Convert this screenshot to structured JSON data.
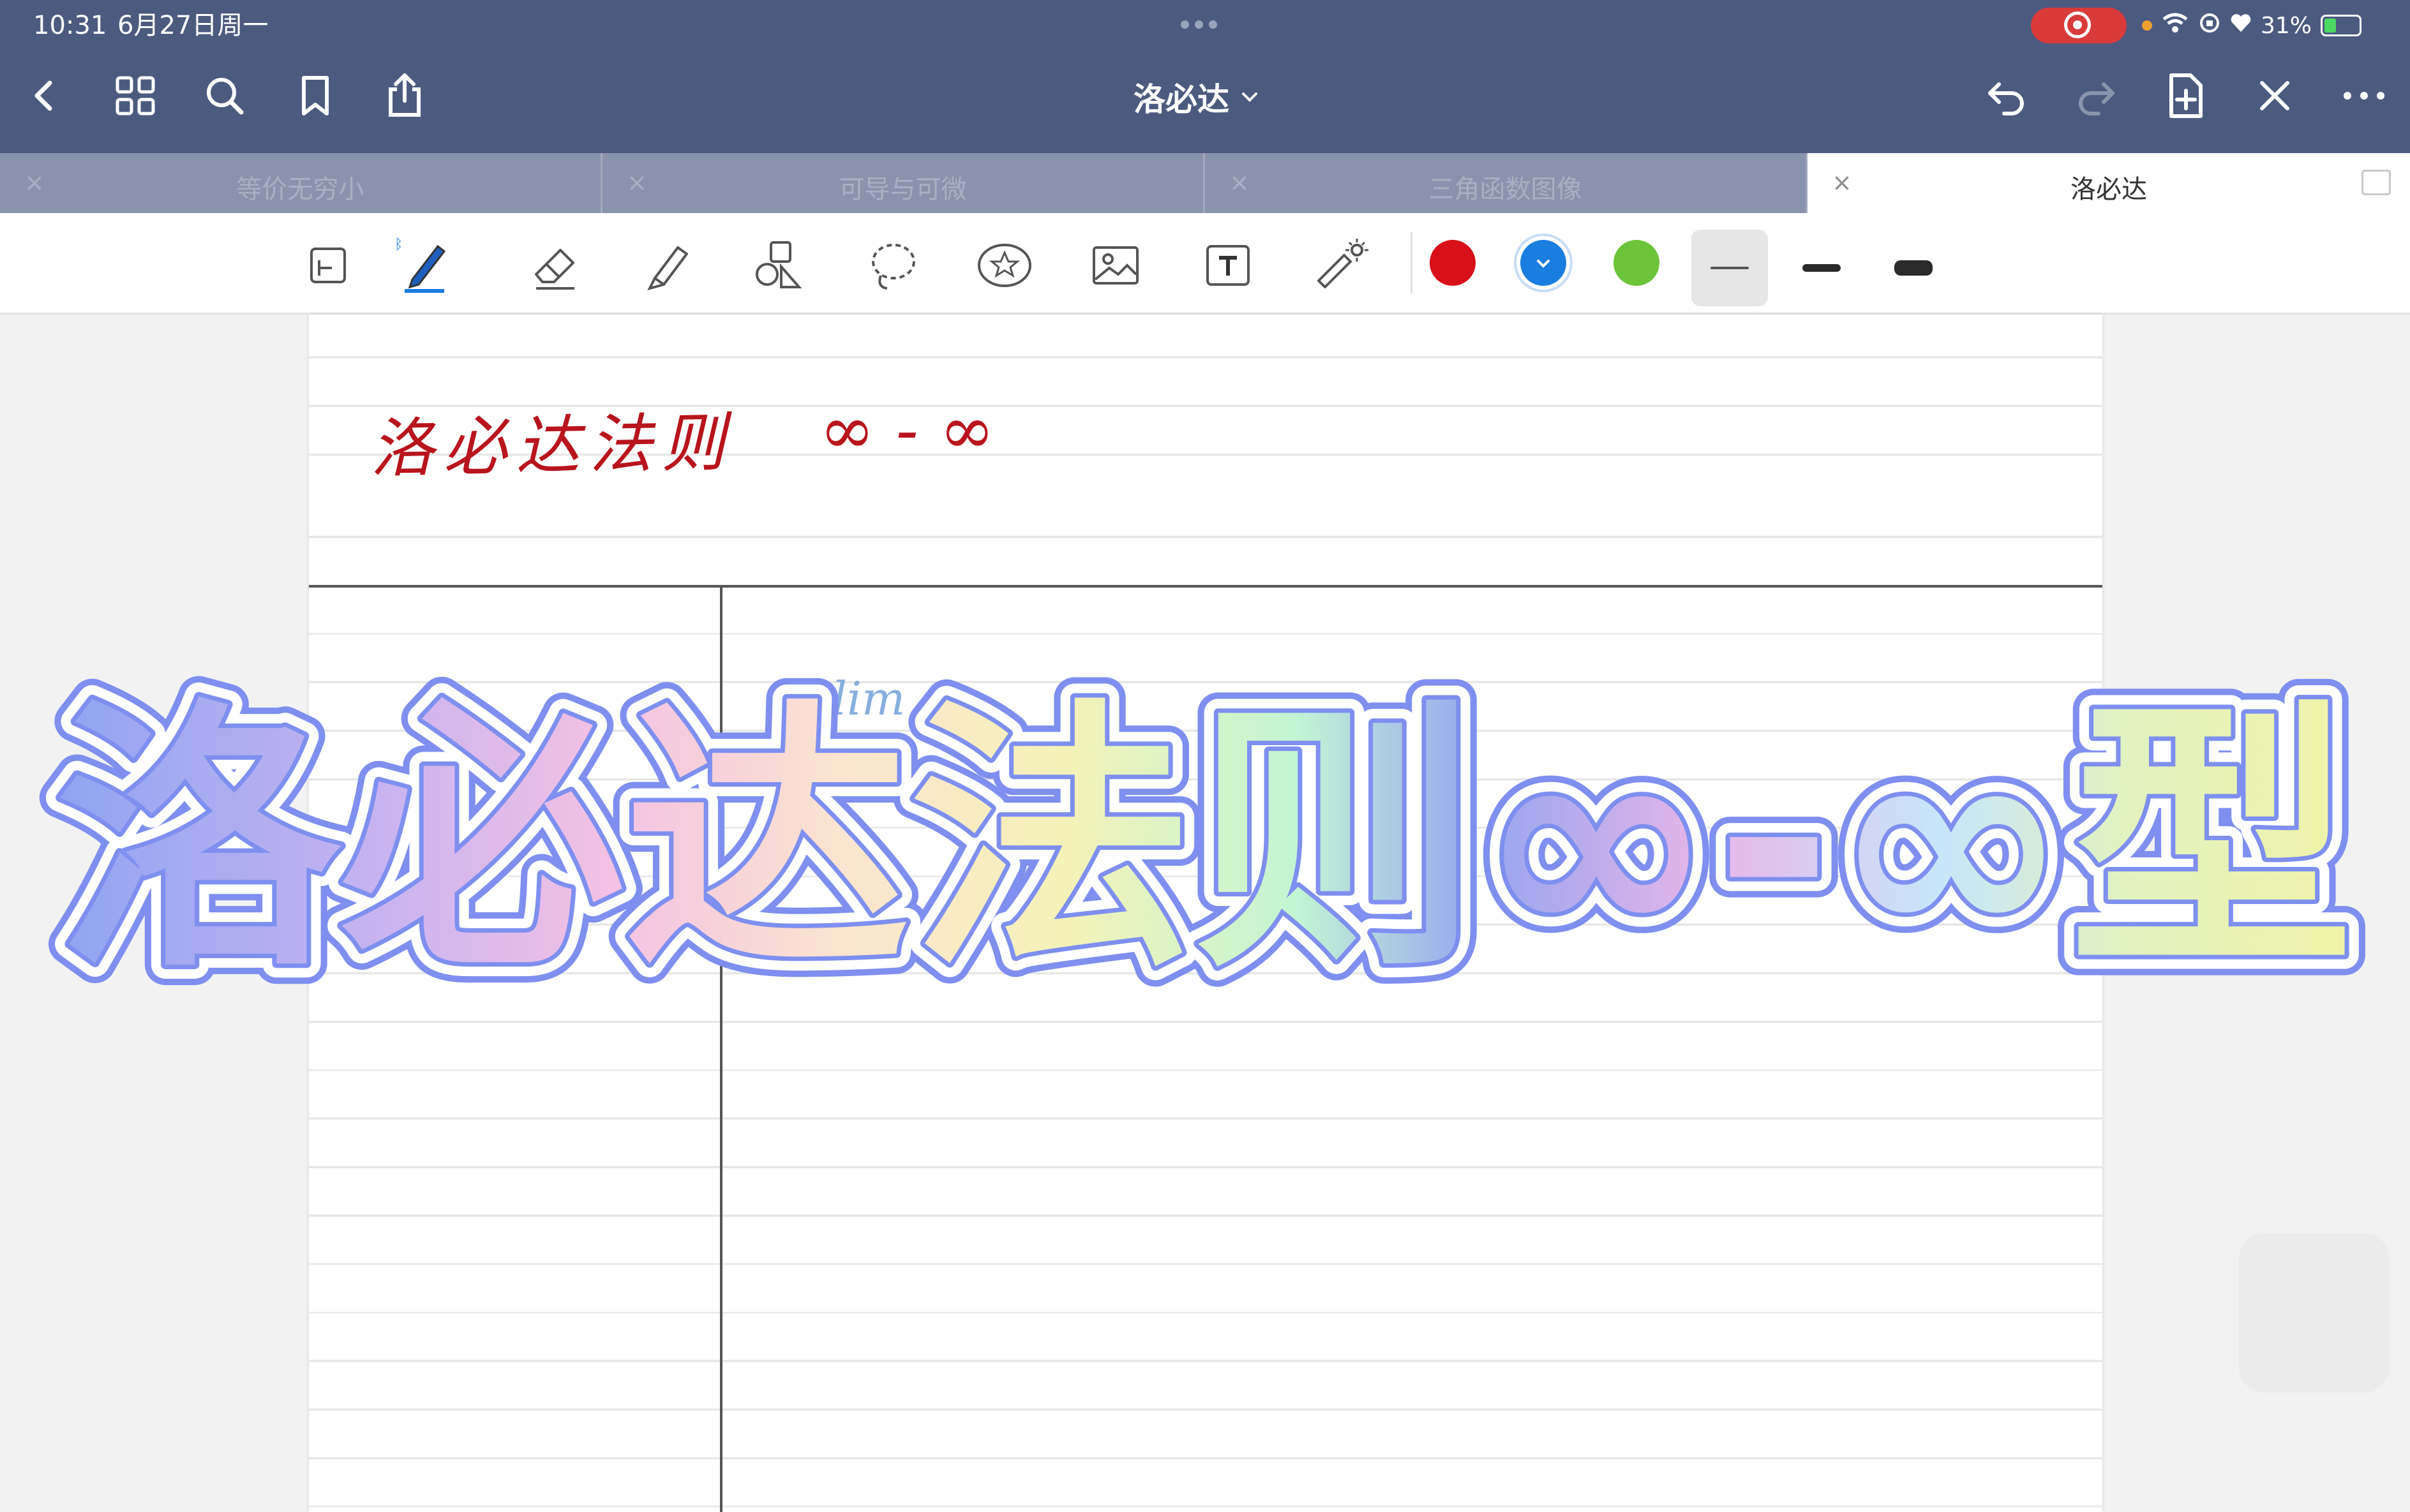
{
  "status_bar": {
    "time": "10:31",
    "date": "6月27日周一",
    "battery_text": "31%"
  },
  "navbar": {
    "doc_title": "洛必达",
    "icons": [
      "back-icon",
      "grid-icon",
      "search-icon",
      "bookmark-icon",
      "share-icon",
      "undo-icon",
      "redo-icon",
      "add-page-icon",
      "close-icon",
      "more-icon"
    ]
  },
  "tabs": [
    {
      "label": "等价无穷小",
      "active": false
    },
    {
      "label": "可导与可微",
      "active": false
    },
    {
      "label": "三角函数图像",
      "active": false
    },
    {
      "label": "洛必达",
      "active": true
    }
  ],
  "tab_close_glyph": "×",
  "toolbar": {
    "tools": [
      "page-layout-icon",
      "pen-icon",
      "eraser-icon",
      "highlighter-icon",
      "shapes-icon",
      "lasso-icon",
      "sticker-icon",
      "image-icon",
      "text-icon",
      "laser-pointer-icon"
    ],
    "selected_tool": "pen-icon",
    "colors": [
      "#d8101a",
      "#1a7de0",
      "#6cc43a"
    ],
    "selected_color": "#1a7de0",
    "stroke_widths": [
      "thin",
      "medium",
      "thick"
    ],
    "selected_stroke": "thin"
  },
  "page": {
    "handwritten_title": "洛必达法则",
    "handwritten_formula": "∞ - ∞",
    "scribble": "lim"
  },
  "banner": {
    "text": "洛必达法则∞-∞型"
  }
}
